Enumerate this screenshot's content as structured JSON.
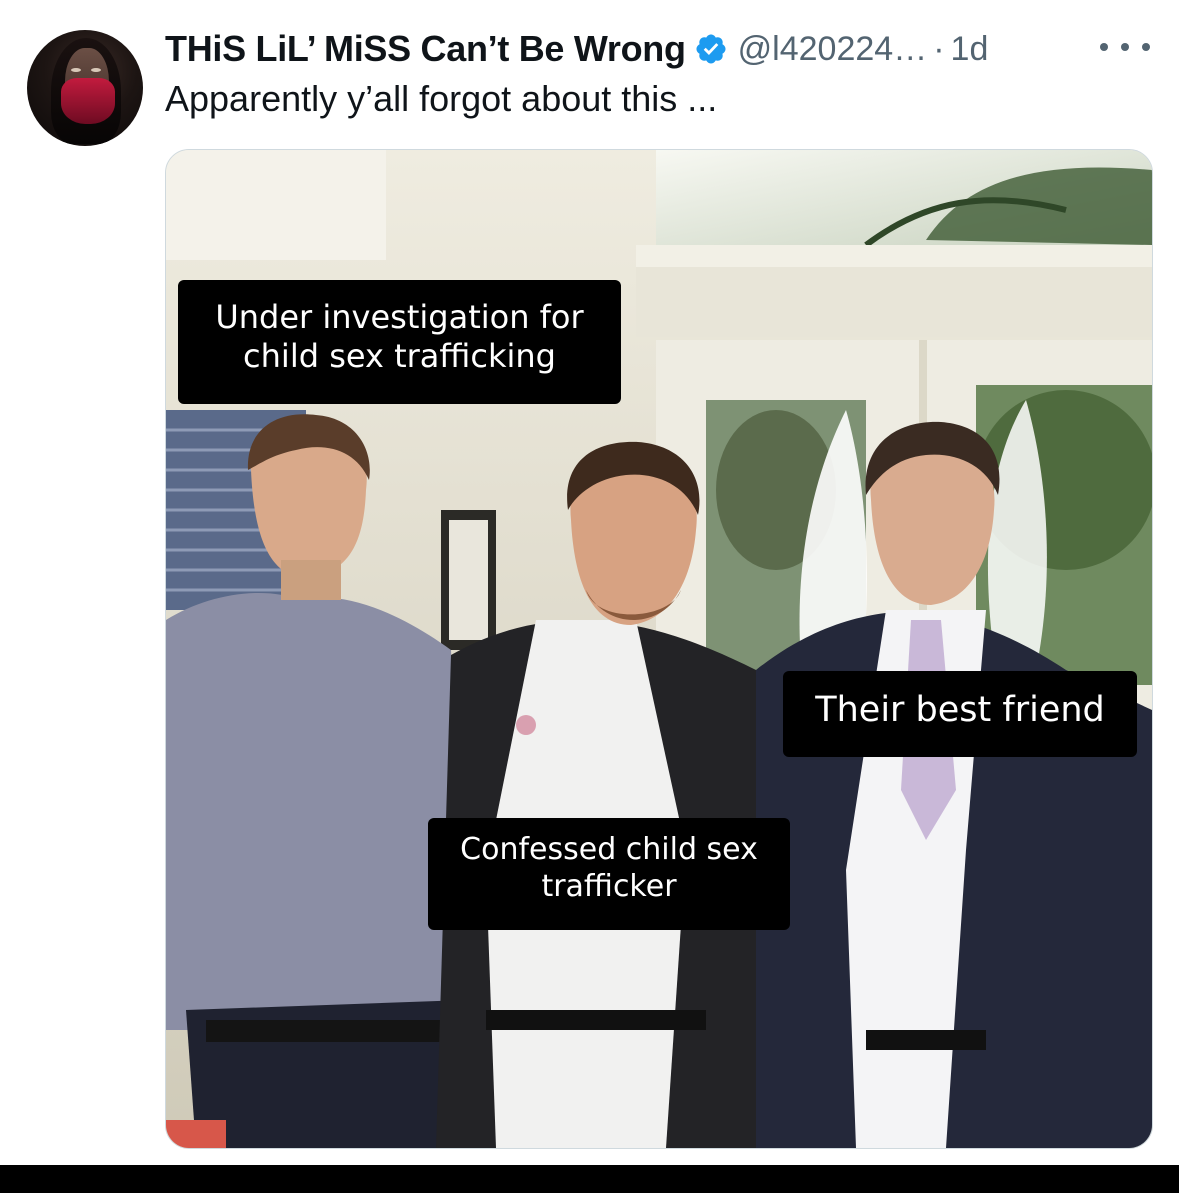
{
  "tweet": {
    "display_name": "THiS LiL’ MiSS Can’t Be Wrong",
    "handle": "@l420224…",
    "separator": "·",
    "time": "1d",
    "text": "Apparently y’all forgot about this ...",
    "verified": true,
    "verified_color": "#1d9bf0",
    "icons": [
      "avatar",
      "verified-badge-icon",
      "more-options-icon"
    ]
  },
  "media": {
    "captions": [
      "Under investigation for child sex trafficking",
      "Their best friend",
      "Confessed child sex trafficker"
    ]
  },
  "colors": {
    "text": "#0f1419",
    "secondary": "#536471",
    "caption_bg": "#000000",
    "caption_text": "#ffffff"
  }
}
